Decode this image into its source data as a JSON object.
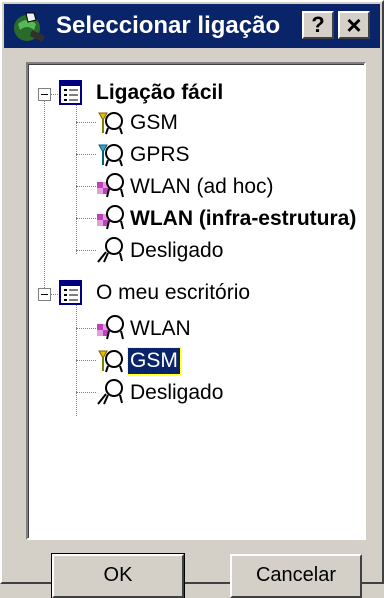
{
  "window": {
    "title": "Seleccionar ligação",
    "help_label": "?",
    "close_label": "×"
  },
  "tree": {
    "groups": [
      {
        "label": "Ligação fácil",
        "items": [
          {
            "label": "GSM",
            "icon": "gsm-connection-icon"
          },
          {
            "label": "GPRS",
            "icon": "gprs-connection-icon"
          },
          {
            "label": "WLAN (ad hoc)",
            "icon": "wlan-connection-icon"
          },
          {
            "label": "WLAN (infra-estrutura)",
            "icon": "wlan-connection-icon"
          },
          {
            "label": "Desligado",
            "icon": "disconnected-icon"
          }
        ]
      },
      {
        "label": "O meu escritório",
        "items": [
          {
            "label": "WLAN",
            "icon": "wlan-connection-icon"
          },
          {
            "label": "GSM",
            "icon": "gsm-connection-icon",
            "selected": true
          },
          {
            "label": "Desligado",
            "icon": "disconnected-icon"
          }
        ]
      }
    ]
  },
  "buttons": {
    "ok": "OK",
    "cancel": "Cancelar"
  },
  "colors": {
    "title_bar": "#0a246a",
    "selection": "#0a246a",
    "face": "#d4d0c8"
  }
}
